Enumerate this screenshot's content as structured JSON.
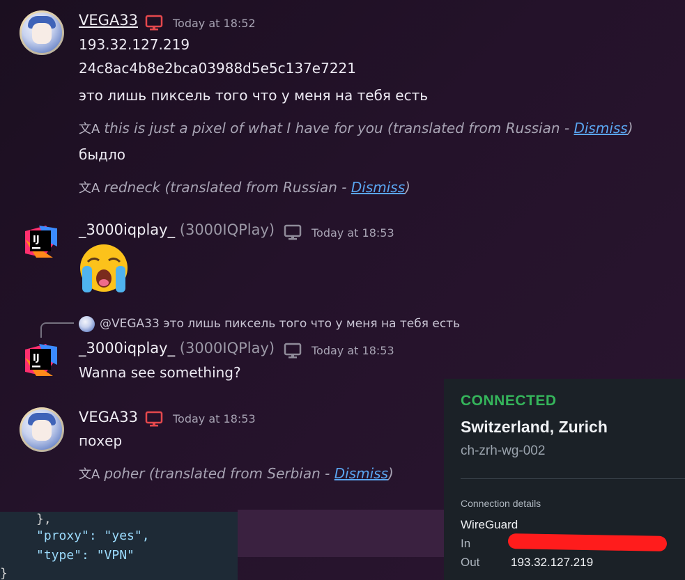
{
  "messages": [
    {
      "username": "VEGA33",
      "timestamp": "Today at 18:52",
      "lines": [
        "193.32.127.219",
        "24c8ac4b8e2bca03988d5e5c137e7221",
        "это лишь пиксель того что у меня на тебя есть"
      ],
      "translation1": "this is just a pixel of what I have for you (translated from Russian - ",
      "line4": "быдло",
      "translation2": "redneck (translated from Russian - ",
      "dismiss": "Dismiss",
      "close_paren": ")"
    },
    {
      "username": "_3000iqplay_",
      "altname": "(3000IQPlay)",
      "timestamp": "Today at 18:53",
      "emoji": "loudly-crying-face"
    },
    {
      "reply_mention": "@VEGA33",
      "reply_text": "это лишь пиксель того что у меня на тебя есть",
      "username": "_3000iqplay_",
      "altname": "(3000IQPlay)",
      "timestamp": "Today at 18:53",
      "text": "Wanna see something?"
    },
    {
      "username": "VEGA33",
      "timestamp": "Today at 18:53",
      "text": "похер",
      "translation": "poher (translated from Serbian - ",
      "dismiss": "Dismiss",
      "close_paren": ")"
    }
  ],
  "icons": {
    "translate": "文A",
    "ij_logo": "IJ"
  },
  "code": {
    "line1": "},",
    "line2": "\"proxy\": \"yes\",",
    "line3": "\"type\": \"VPN\"",
    "line4": "}"
  },
  "vpn": {
    "status": "CONNECTED",
    "location": "Switzerland, Zurich",
    "server": "ch-zrh-wg-002",
    "details_label": "Connection details",
    "protocol": "WireGuard",
    "in_label": "In",
    "out_label": "Out",
    "out_value": "193.32.127.219"
  },
  "colors": {
    "connected": "#35b55b",
    "dismiss_link": "#5aa5f0",
    "monitor_red": "#e5484d",
    "monitor_grey": "#8f8b99",
    "redaction": "#ff1c1c"
  }
}
